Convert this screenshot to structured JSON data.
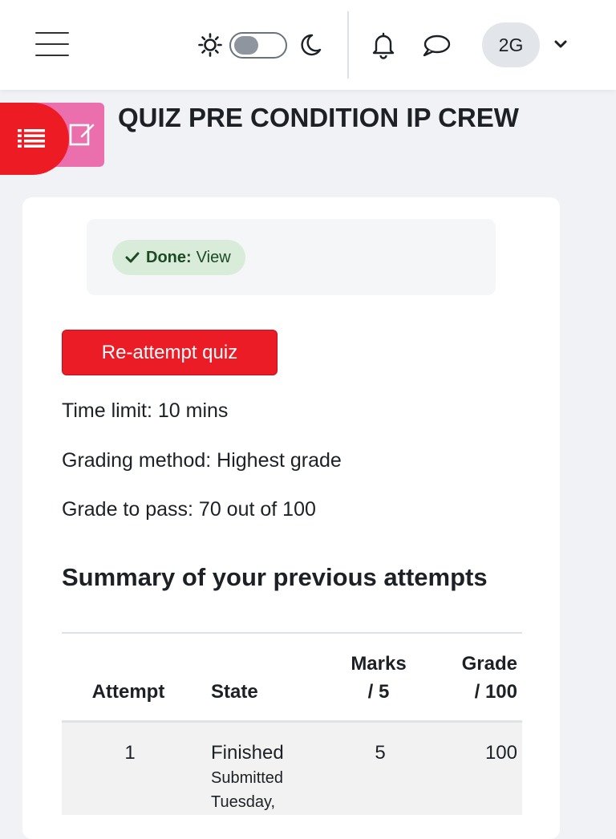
{
  "header": {
    "menu_icon": "hamburger-icon",
    "theme_light_icon": "sun-icon",
    "theme_dark_icon": "moon-icon",
    "notifications_icon": "bell-icon",
    "messages_icon": "chat-bubble-icon",
    "user_initials": "2G",
    "user_menu_icon": "chevron-down-icon"
  },
  "page": {
    "title": "QUIZ PRE CONDITION IP CREW",
    "activity_icon": "quiz-icon",
    "drawer_icon": "list-icon"
  },
  "completion": {
    "label": "Done:",
    "link": "View"
  },
  "actions": {
    "reattempt_label": "Re-attempt quiz"
  },
  "info": {
    "time_limit": "Time limit: 10 mins",
    "grading_method": "Grading method: Highest grade",
    "grade_to_pass": "Grade to pass: 70 out of 100"
  },
  "summary": {
    "title": "Summary of your previous attempts",
    "columns": {
      "attempt": "Attempt",
      "state": "State",
      "marks_line1": "Marks",
      "marks_line2": "/ 5",
      "grade_line1": "Grade",
      "grade_line2": "/ 100"
    },
    "rows": [
      {
        "attempt": "1",
        "state": "Finished",
        "submitted_line1": "Submitted",
        "submitted_line2": "Tuesday,",
        "marks": "5",
        "grade": "100"
      }
    ]
  },
  "colors": {
    "brand_red": "#ec1c27",
    "activity_pink": "#eb6ead",
    "done_bg": "#d9ecd9",
    "done_text": "#1c4a25"
  }
}
